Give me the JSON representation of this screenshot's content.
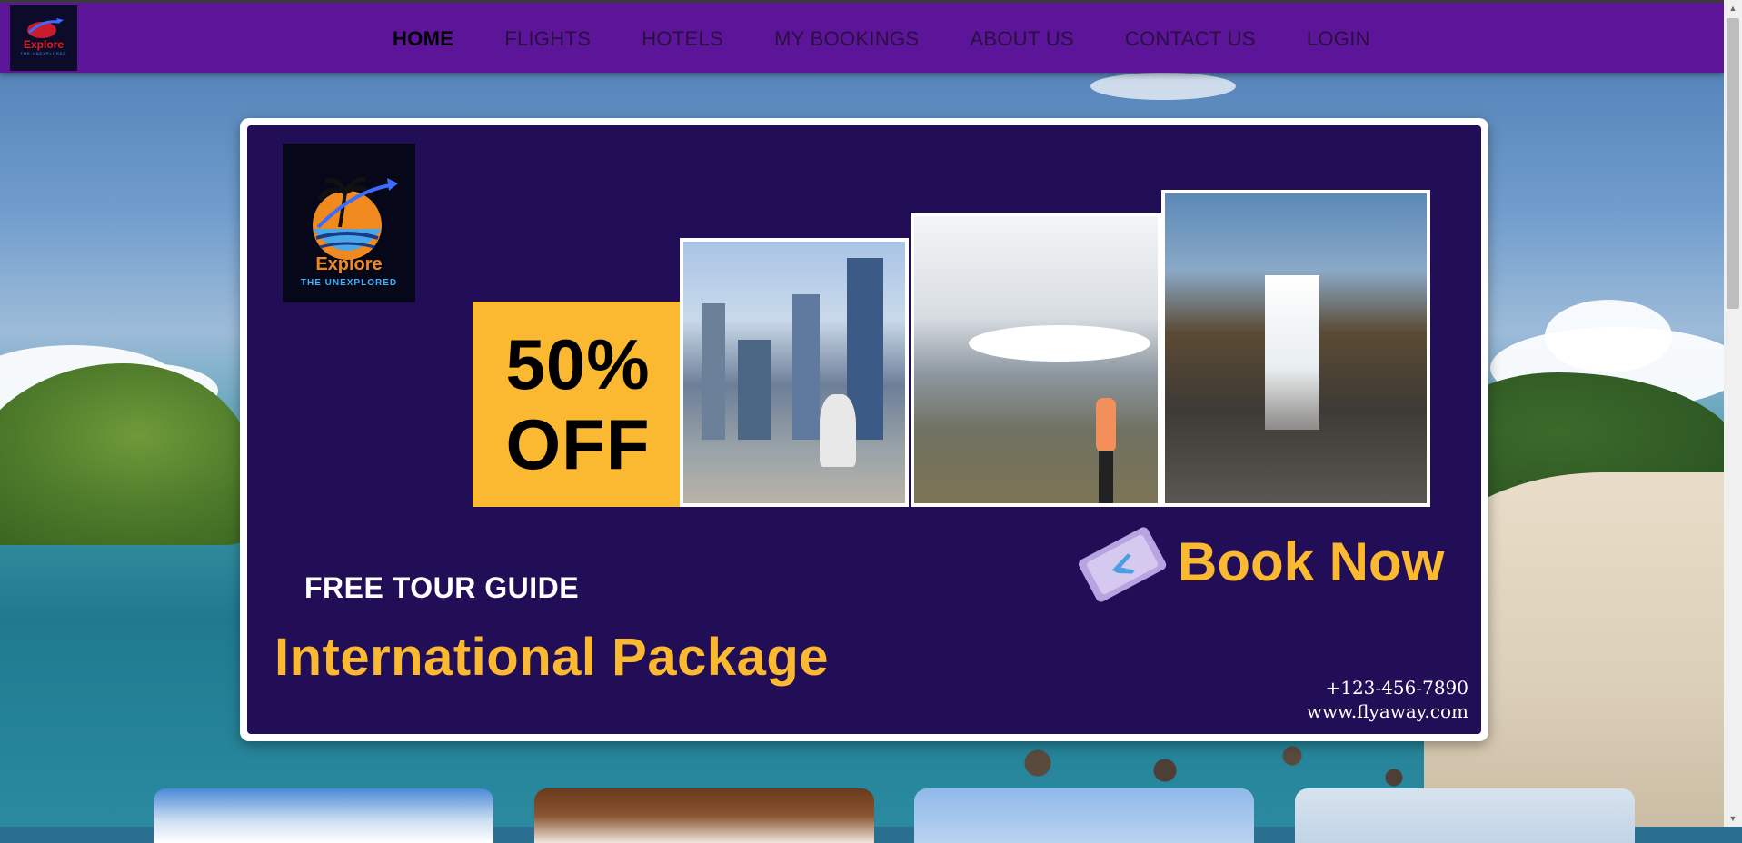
{
  "nav": {
    "logo": {
      "word": "Explore",
      "tag": "THE UNEXPLORED"
    },
    "links": [
      "HOME",
      "FLIGHTS",
      "HOTELS",
      "MY BOOKINGS",
      "ABOUT US",
      "CONTACT US",
      "LOGIN"
    ],
    "active": "HOME"
  },
  "banner": {
    "logo_word": "Explore",
    "logo_tag": "THE UNEXPLORED",
    "offer_line1": "50%",
    "offer_line2": "OFF",
    "free_guide": "FREE TOUR GUIDE",
    "package": "International Package",
    "cta": "Book Now",
    "phone": "+123-456-7890",
    "website": "www.flyaway.com"
  },
  "colors": {
    "nav_bg": "#5c1599",
    "banner_bg": "#220d57",
    "accent_yellow": "#fbb932"
  },
  "icons": {
    "scroll_up": "▲",
    "scroll_down": "▼"
  }
}
